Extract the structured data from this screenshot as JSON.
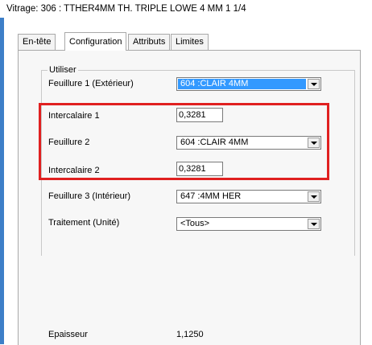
{
  "window": {
    "title": "Vitrage: 306 : TTHER4MM TH. TRIPLE LOWE 4 MM 1 1/4"
  },
  "tabs": [
    {
      "label": "En-tête"
    },
    {
      "label": "Configuration",
      "active": true
    },
    {
      "label": "Attributs"
    },
    {
      "label": "Limites"
    }
  ],
  "group": {
    "label": "Utiliser"
  },
  "fields": {
    "feuillure1": {
      "label": "Feuillure 1 (Extérieur)",
      "value": "604 :CLAIR 4MM"
    },
    "intercalaire1": {
      "label": "Intercalaire 1",
      "value": "0,3281"
    },
    "feuillure2": {
      "label": "Feuillure 2",
      "value": "604 :CLAIR 4MM"
    },
    "intercalaire2": {
      "label": "Intercalaire 2",
      "value": "0,3281"
    },
    "feuillure3": {
      "label": "Feuillure 3 (Intérieur)",
      "value": "647 :4MM HER"
    },
    "traitement": {
      "label": "Traitement (Unité)",
      "value": "<Tous>"
    }
  },
  "epaisseur": {
    "label": "Epaisseur",
    "value": "1,1250"
  },
  "colors": {
    "highlight": "#e02020",
    "selection": "#3399ff",
    "window_border": "#3d7fc8"
  }
}
